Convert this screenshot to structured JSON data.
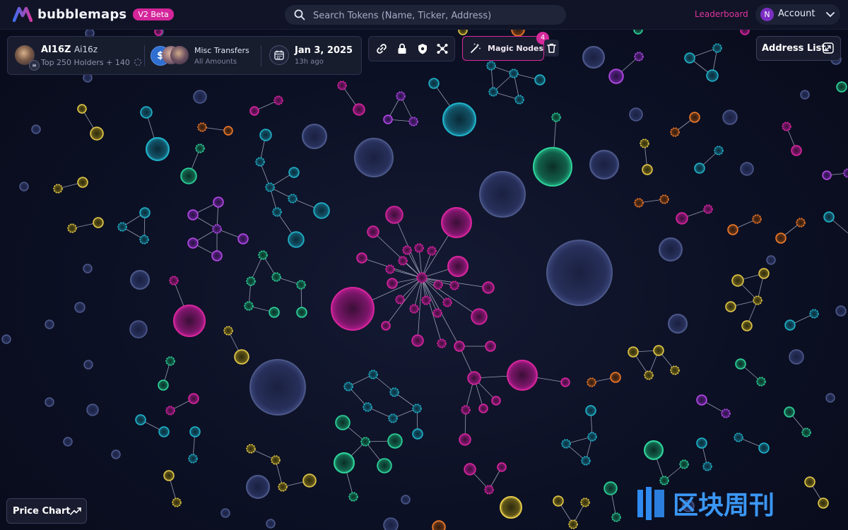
{
  "header": {
    "logo_text": "bubblemaps",
    "beta_badge": "V2 Beta",
    "search_placeholder": "Search Tokens (Name, Ticker, Address)",
    "leaderboard": "Leaderboard",
    "account": {
      "initial": "N",
      "label": "Account"
    }
  },
  "token": {
    "symbol": "AI16Z",
    "name": "Ai16z",
    "holders": "Top 250 Holders + 140"
  },
  "transfers": {
    "title": "Misc Transfers",
    "subtitle": "All Amounts",
    "coin_glyph": "$"
  },
  "date": {
    "main": "Jan 3, 2025",
    "sub": "13h ago"
  },
  "toolbar": {
    "icons": [
      "link-icon",
      "lock-icon",
      "shield-icon",
      "cluster-icon"
    ],
    "magic_nodes_label": "Magic Nodes",
    "magic_nodes_count": "4"
  },
  "address_list": "Address List",
  "price_chart": "Price Chart",
  "watermark_text": "区块周刊",
  "colors": {
    "background": "#0c1024",
    "accent_pink": "#d62a9b",
    "node_pink": "#d7269c",
    "node_purple": "#b549e6",
    "node_teal": "#1fb3c8",
    "node_green": "#2fd39a",
    "node_yellow": "#e3c94a",
    "node_orange": "#ee7a2a",
    "node_slate": "#5a6690"
  }
}
